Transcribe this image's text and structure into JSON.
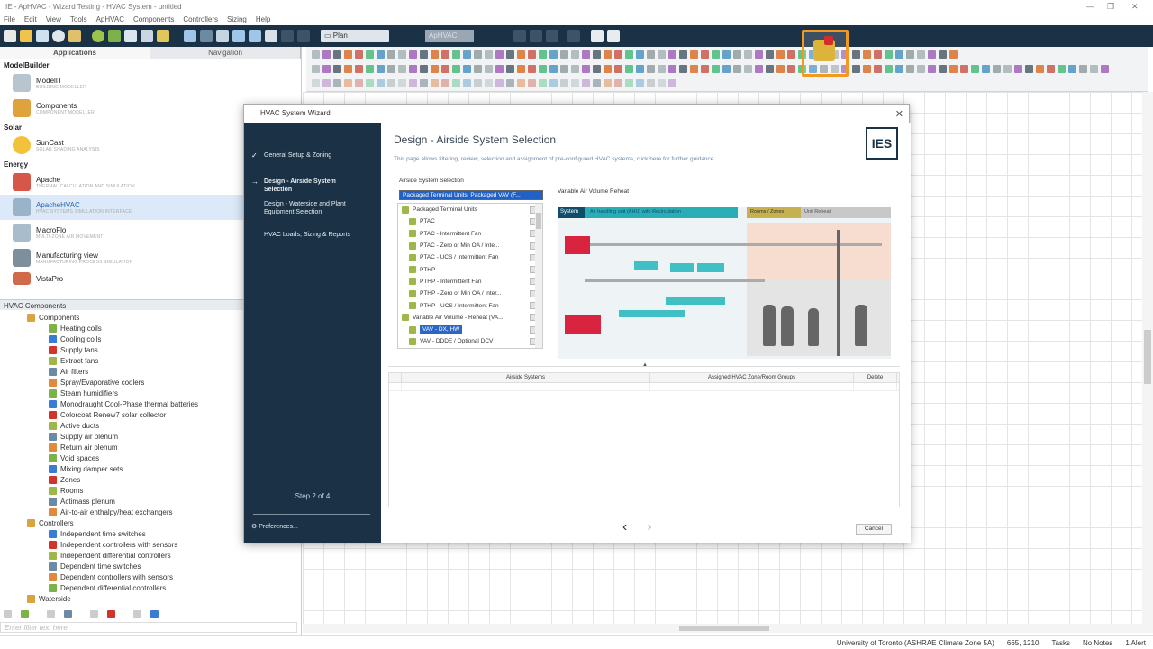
{
  "window": {
    "title": "IE - ApHVAC - Wizard Testing - HVAC System - untitled"
  },
  "menu": [
    "File",
    "Edit",
    "View",
    "Tools",
    "ApHVAC",
    "Components",
    "Controllers",
    "Sizing",
    "Help"
  ],
  "toolbar": {
    "view_select": "Plan",
    "mode_select": "ApHVAC"
  },
  "left_panel": {
    "tabs": [
      "Applications",
      "Navigation"
    ],
    "sections": [
      {
        "name": "ModelBuilder",
        "apps": [
          {
            "name": "ModelIT",
            "desc": "BUILDING MODELLER"
          },
          {
            "name": "Components",
            "desc": "COMPONENT MODELLER"
          }
        ]
      },
      {
        "name": "Solar",
        "apps": [
          {
            "name": "SunCast",
            "desc": "SOLAR SHADING ANALYSIS"
          }
        ]
      },
      {
        "name": "Energy",
        "apps": [
          {
            "name": "Apache",
            "desc": "THERMAL CALCULATION AND SIMULATION"
          },
          {
            "name": "ApacheHVAC",
            "desc": "HVAC SYSTEMS SIMULATION INTERFACE"
          },
          {
            "name": "MacroFlo",
            "desc": "MULTI-ZONE AIR MOVEMENT"
          },
          {
            "name": "Manufacturing view",
            "desc": "MANUFACTURING PROCESS SIMULATION"
          },
          {
            "name": "VistaPro",
            "desc": ""
          }
        ]
      }
    ],
    "hvac_header": "HVAC Components",
    "tree": [
      {
        "label": "Components",
        "level": 1
      },
      {
        "label": "Heating coils",
        "level": 2
      },
      {
        "label": "Cooling coils",
        "level": 2
      },
      {
        "label": "Supply fans",
        "level": 2
      },
      {
        "label": "Extract fans",
        "level": 2
      },
      {
        "label": "Air filters",
        "level": 2
      },
      {
        "label": "Spray/Evaporative coolers",
        "level": 2
      },
      {
        "label": "Steam humidifiers",
        "level": 2
      },
      {
        "label": "Monodraught Cool-Phase thermal batteries",
        "level": 2
      },
      {
        "label": "Colorcoat Renew7 solar collector",
        "level": 2
      },
      {
        "label": "Active ducts",
        "level": 2
      },
      {
        "label": "Supply air plenum",
        "level": 2
      },
      {
        "label": "Return air plenum",
        "level": 2
      },
      {
        "label": "Void spaces",
        "level": 2
      },
      {
        "label": "Mixing damper sets",
        "level": 2
      },
      {
        "label": "Zones",
        "level": 2
      },
      {
        "label": "Rooms",
        "level": 2
      },
      {
        "label": "Actimass plenum",
        "level": 2
      },
      {
        "label": "Air-to-air enthalpy/heat exchangers",
        "level": 2
      },
      {
        "label": "Controllers",
        "level": 1
      },
      {
        "label": "Independent time switches",
        "level": 2
      },
      {
        "label": "Independent controllers with sensors",
        "level": 2
      },
      {
        "label": "Independent differential controllers",
        "level": 2
      },
      {
        "label": "Dependent time switches",
        "level": 2
      },
      {
        "label": "Dependent controllers with sensors",
        "level": 2
      },
      {
        "label": "Dependent differential controllers",
        "level": 2
      },
      {
        "label": "Waterside",
        "level": 1
      }
    ],
    "filter_placeholder": "Enter filter text here"
  },
  "status": {
    "location": "University of Toronto (ASHRAE Climate Zone 5A)",
    "coords": "665, 1210",
    "tasks": "Tasks",
    "notes": "No Notes",
    "alerts": "1 Alert"
  },
  "dialog": {
    "title": "HVAC System Wizard",
    "steps": [
      {
        "label": "General Setup & Zoning",
        "state": "done"
      },
      {
        "label": "Design - Airside System Selection",
        "state": "current"
      },
      {
        "label": "Design - Waterside and Plant Equipment Selection",
        "state": "todo"
      },
      {
        "label": "HVAC Loads, Sizing & Reports",
        "state": "todo"
      }
    ],
    "step_count": "Step 2 of 4",
    "preferences": "Preferences...",
    "heading": "Design - Airside System Selection",
    "subtitle": "This page allows filtering, review, selection and assignment of pre-configured HVAC systems, click here for further guidance.",
    "logo": "IES",
    "airside_label": "Airside System Selection",
    "combo_value": "Packaged Terminal Units, Packaged VAV (F...",
    "list": [
      {
        "label": "Packaged Terminal Units",
        "group": true
      },
      {
        "label": "PTAC",
        "group": false
      },
      {
        "label": "PTAC - Intermittent Fan",
        "group": false
      },
      {
        "label": "PTAC - Zero or Min OA / Inte...",
        "group": false
      },
      {
        "label": "PTAC - UCS / Intermittent Fan",
        "group": false
      },
      {
        "label": "PTHP",
        "group": false
      },
      {
        "label": "PTHP - Intermittent Fan",
        "group": false
      },
      {
        "label": "PTHP - Zero or Min OA / Inter...",
        "group": false
      },
      {
        "label": "PTHP - UCS / Intermittent Fan",
        "group": false
      },
      {
        "label": "Variable Air Volume - Reheat (VA...",
        "group": true
      },
      {
        "label": "VAV - DX, HW",
        "group": false,
        "selected": true
      },
      {
        "label": "VAV - DDDE / Optional DCV",
        "group": false
      }
    ],
    "preview_title": "Variable Air Volume Reheat",
    "diagram": {
      "system_tab": "System",
      "system_desc": "Air handling unit (AHU) with Recirculation",
      "rooms_tab": "Rooms / Zones",
      "rooms_desc": "Unit Reheat"
    },
    "grid_headers": [
      "Airside Systems",
      "Assigned HVAC Zone/Room Groups",
      "Delete"
    ],
    "cancel": "Cancel"
  }
}
